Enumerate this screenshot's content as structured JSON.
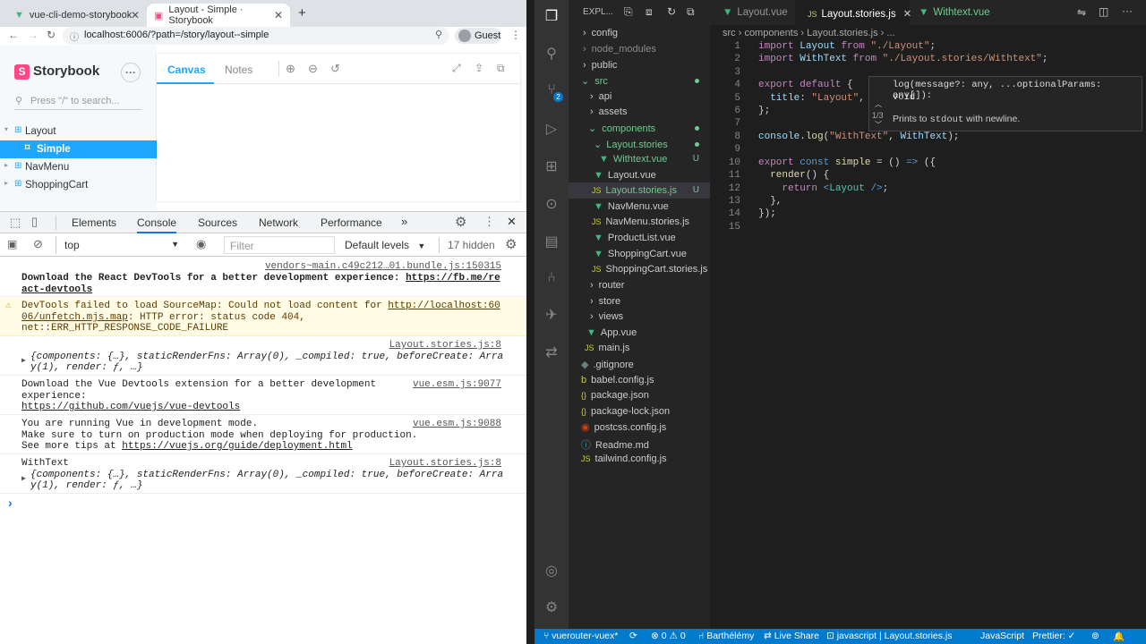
{
  "browser": {
    "tabs": [
      {
        "label": "vue-cli-demo-storybook"
      },
      {
        "label": "Layout - Simple · Storybook"
      }
    ],
    "url": "localhost:6006/?path=/story/layout--simple",
    "profile": "Guest"
  },
  "storybook": {
    "brand": "Storybook",
    "search_placeholder": "Press \"/\" to search...",
    "tree": [
      {
        "label": "Layout"
      },
      {
        "label": "Simple"
      },
      {
        "label": "NavMenu"
      },
      {
        "label": "ShoppingCart"
      }
    ],
    "tabs": {
      "canvas": "Canvas",
      "notes": "Notes"
    }
  },
  "devtools": {
    "tabs": [
      "Elements",
      "Console",
      "Sources",
      "Network",
      "Performance"
    ],
    "context": "top",
    "filter_placeholder": "Filter",
    "levels": "Default levels",
    "hidden": "17 hidden",
    "console": [
      {
        "src": "vendors~main.c49c212…01.bundle.js:150315",
        "text1": "Download the React DevTools for a better development experience: ",
        "link": "https://fb.me/re",
        "text2": "act-devtools"
      },
      {
        "text1": "DevTools failed to load SourceMap: Could not load content for ",
        "link": "http://localhost:60",
        "link2": "06/unfetch.mjs.map",
        "text2": ": HTTP error: status code 404,",
        "text3": "net::ERR_HTTP_RESPONSE_CODE_FAILURE"
      },
      {
        "src": "Layout.stories.js:8",
        "obj1": "{components: {…}, staticRenderFns: Array(0), _compiled: true, beforeCreate: Arra",
        "obj2": "y(1), render: ƒ, …}"
      },
      {
        "src": "vue.esm.js:9077",
        "text1": "Download the Vue Devtools extension for a better development",
        "text2": "experience:",
        "link": "https://github.com/vuejs/vue-devtools"
      },
      {
        "src": "vue.esm.js:9088",
        "text1": "You are running Vue in development mode.",
        "text2": "Make sure to turn on production mode when deploying for production.",
        "text3": "See more tips at ",
        "link": "https://vuejs.org/guide/deployment.html"
      },
      {
        "src": "Layout.stories.js:8",
        "text1": "WithText",
        "obj1": "{components: {…}, staticRenderFns: Array(0), _compiled: true, beforeCreate: Arra",
        "obj2": "y(1), render: ƒ, …}"
      }
    ],
    "prompt": "›"
  },
  "vscode": {
    "explorer_title": "EXPL...",
    "files": [
      {
        "label": "config"
      },
      {
        "label": "node_modules"
      },
      {
        "label": "public"
      },
      {
        "label": "src"
      },
      {
        "label": "api"
      },
      {
        "label": "assets"
      },
      {
        "label": "components"
      },
      {
        "label": "Layout.stories"
      },
      {
        "label": "Withtext.vue",
        "badge": "U"
      },
      {
        "label": "Layout.vue"
      },
      {
        "label": "Layout.stories.js",
        "badge": "U"
      },
      {
        "label": "NavMenu.vue"
      },
      {
        "label": "NavMenu.stories.js"
      },
      {
        "label": "ProductList.vue"
      },
      {
        "label": "ShoppingCart.vue"
      },
      {
        "label": "ShoppingCart.stories.js"
      },
      {
        "label": "router"
      },
      {
        "label": "store"
      },
      {
        "label": "views"
      },
      {
        "label": "App.vue"
      },
      {
        "label": "main.js"
      },
      {
        "label": ".gitignore"
      },
      {
        "label": "babel.config.js"
      },
      {
        "label": "package.json"
      },
      {
        "label": "package-lock.json"
      },
      {
        "label": "postcss.config.js"
      },
      {
        "label": "Readme.md"
      },
      {
        "label": "tailwind.config.js"
      }
    ],
    "editor_tabs": [
      "Layout.vue",
      "Layout.stories.js",
      "Withtext.vue"
    ],
    "breadcrumb": "src › components › Layout.stories.js › ...",
    "hover": {
      "signature": "log(message?: any, ...optionalParams: any[]):",
      "ret": "void",
      "count": "1/3",
      "doc1": "Prints to ",
      "doc2": "stdout",
      "doc3": " with newline."
    },
    "status": {
      "branch": "vuerouter-vuex*",
      "errors": "0",
      "warnings": "0",
      "user": "Barthélémy",
      "liveshare": "Live Share",
      "lang_status": "javascript | Layout.stories.js",
      "lang": "JavaScript",
      "prettier": "Prettier: ✓"
    }
  }
}
